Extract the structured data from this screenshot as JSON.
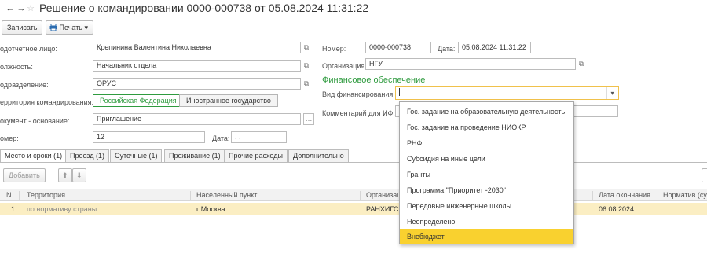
{
  "window": {
    "back_glyph": "←",
    "forward_glyph": "→",
    "favorite_glyph": "☆",
    "title": "Решение о командировании 0000-000738 от 05.08.2024 11:31:22"
  },
  "toolbar": {
    "save_label": "Записать",
    "print_label": "Печать",
    "print_dropdown_glyph": "▾"
  },
  "form": {
    "person_label": "одотчетное лицо:",
    "person_value": "Крепинина Валентина Николаевна",
    "position_label": "олжность:",
    "position_value": "Начальник отдела",
    "department_label": "одразделение:",
    "department_value": "ОРУС",
    "territory_label": "ерритория командирования:",
    "territory_options": [
      "Российская Федерация",
      "Иностранное государство"
    ],
    "basis_label": "окумент - основание:",
    "basis_value": "Приглашение",
    "number2_label": "омер:",
    "number2_value": "12",
    "date2_label": "Дата:",
    "date2_value": ". .",
    "number_label": "Номер:",
    "number_value": "0000-000738",
    "date_label": "Дата:",
    "date_value": "05.08.2024 11:31:22",
    "org_label": "Организация:",
    "org_value": "НГУ",
    "finance_section_title": "Финансовое обеспечение",
    "finance_type_label": "Вид финансирования:",
    "finance_type_value": "",
    "finance_comment_label": "Комментарий для ИФ:",
    "open_glyph": "⧉",
    "select_glyph": "…",
    "dropdown_glyph": "▾"
  },
  "tabs": [
    "Место и сроки (1)",
    "Проезд (1)",
    "Суточные (1)",
    "Проживание (1)",
    "Прочие расходы",
    "Дополнительно"
  ],
  "table_toolbar": {
    "add_label": "Добавить",
    "up_glyph": "⬆",
    "down_glyph": "⬇"
  },
  "table": {
    "columns": [
      "N",
      "Территория",
      "Населенный пункт",
      "Организац",
      "Дата окончания",
      "Норматив (сут"
    ],
    "rows": [
      {
        "n": "1",
        "territory": "по нормативу страны",
        "city": "г Москва",
        "org": "РАНХИГС",
        "end_date": "06.08.2024",
        "norm": ""
      }
    ]
  },
  "dropdown": {
    "items": [
      "Гос. задание на образовательную деятельность",
      "Гос. задание на проведение НИОКР",
      "РНФ",
      "Субсидия на иные цели",
      "Гранты",
      "Программа \"Приоритет -2030\"",
      "Передовые инженерные школы",
      "Неопределено",
      "Внебюджет"
    ],
    "selected_index": 8
  },
  "colors": {
    "accent_green": "#2f9b3f",
    "highlight_yellow": "#f9d12f",
    "row_highlight": "#fbeec3",
    "focus_border": "#f0c14b"
  }
}
